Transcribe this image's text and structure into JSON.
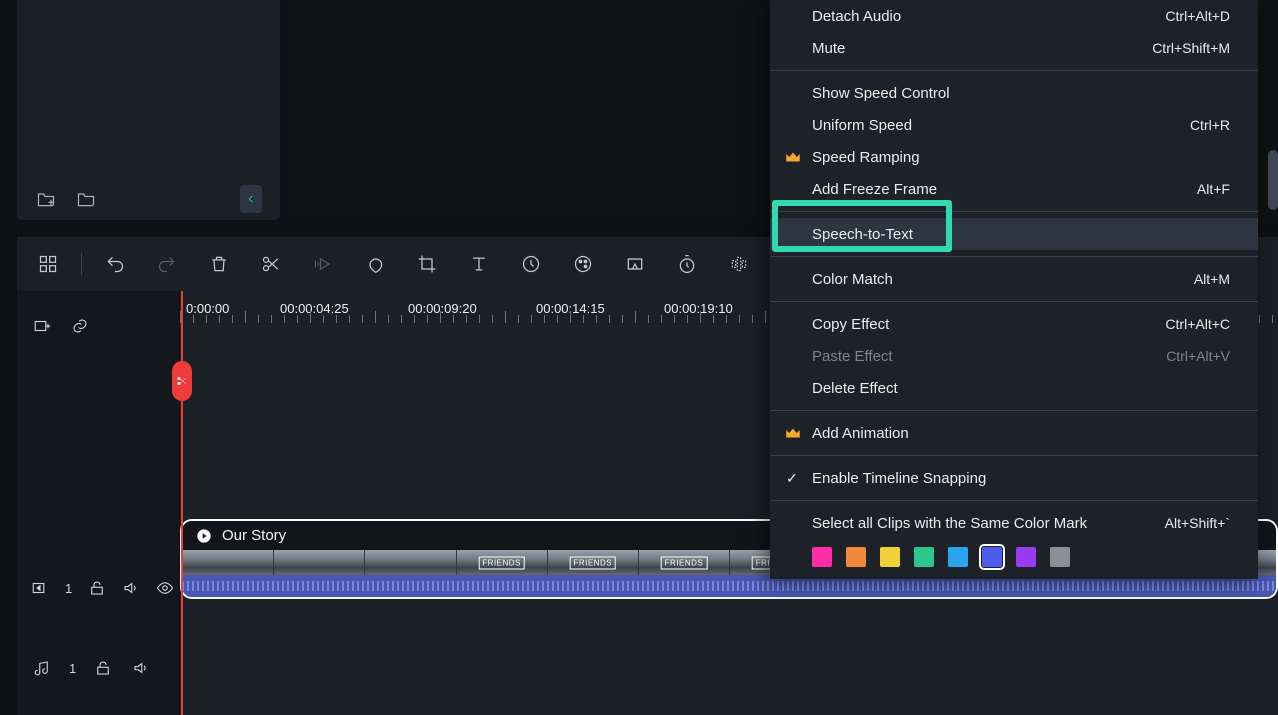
{
  "ruler": {
    "labels": [
      "0:00:00",
      "00:00:04:25",
      "00:00:09:20",
      "00:00:14:15",
      "00:00:19:10"
    ]
  },
  "tracks": {
    "video": {
      "badge": "1",
      "clipTitle": "Our Story"
    },
    "audio": {
      "badge": "1"
    }
  },
  "contextMenu": {
    "items": [
      {
        "label": "Detach Audio",
        "shortcut": "Ctrl+Alt+D"
      },
      {
        "label": "Mute",
        "shortcut": "Ctrl+Shift+M"
      },
      {
        "type": "div"
      },
      {
        "label": "Show Speed Control"
      },
      {
        "label": "Uniform Speed",
        "shortcut": "Ctrl+R"
      },
      {
        "label": "Speed Ramping",
        "crown": true
      },
      {
        "label": "Add Freeze Frame",
        "shortcut": "Alt+F"
      },
      {
        "type": "div"
      },
      {
        "label": "Speech-to-Text",
        "highlight": true
      },
      {
        "type": "div"
      },
      {
        "label": "Color Match",
        "shortcut": "Alt+M"
      },
      {
        "type": "div"
      },
      {
        "label": "Copy Effect",
        "shortcut": "Ctrl+Alt+C"
      },
      {
        "label": "Paste Effect",
        "shortcut": "Ctrl+Alt+V",
        "dim": true
      },
      {
        "label": "Delete Effect"
      },
      {
        "type": "div"
      },
      {
        "label": "Add Animation",
        "crown": true
      },
      {
        "type": "div"
      },
      {
        "label": "Enable Timeline Snapping",
        "check": true
      },
      {
        "type": "div"
      },
      {
        "label": "Select all Clips with the Same Color Mark",
        "shortcut": "Alt+Shift+`"
      }
    ],
    "colors": [
      "#ff2ea6",
      "#f0893a",
      "#f0d13a",
      "#2bc78b",
      "#2ba4f0",
      "#4d5bf0",
      "#9a3af0",
      "#8a9097"
    ],
    "selectedColorIndex": 5
  }
}
